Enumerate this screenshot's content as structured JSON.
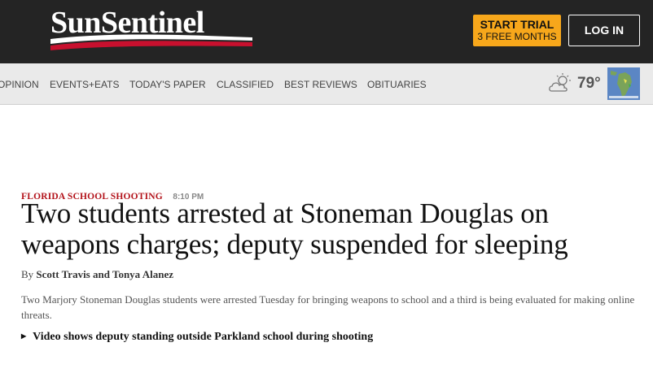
{
  "header": {
    "logo_text": "SunSentinel",
    "trial_button": {
      "line1": "START TRIAL",
      "line2": "3 FREE MONTHS"
    },
    "login_label": "LOG IN",
    "colors": {
      "bar": "#242424",
      "trial": "#f7a71b",
      "logo_swoosh": "#c8102e"
    }
  },
  "nav": {
    "items": [
      "OPINION",
      "EVENTS+EATS",
      "TODAY'S PAPER",
      "CLASSIFIED",
      "BEST REVIEWS",
      "OBITUARIES"
    ]
  },
  "weather": {
    "icon": "partly-cloudy-icon",
    "temperature": "79°"
  },
  "article": {
    "kicker": "FLORIDA SCHOOL SHOOTING",
    "time": "8:10 PM",
    "headline": "Two students arrested at Stoneman Douglas on weapons charges; deputy suspended for sleeping",
    "byline_prefix": "By",
    "authors": "Scott Travis and Tonya Alanez",
    "summary": "Two Marjory Stoneman Douglas students were arrested Tuesday for bringing weapons to school and a third is being evaluated for making online threats.",
    "related_link": "Video shows deputy standing outside Parkland school during shooting"
  }
}
